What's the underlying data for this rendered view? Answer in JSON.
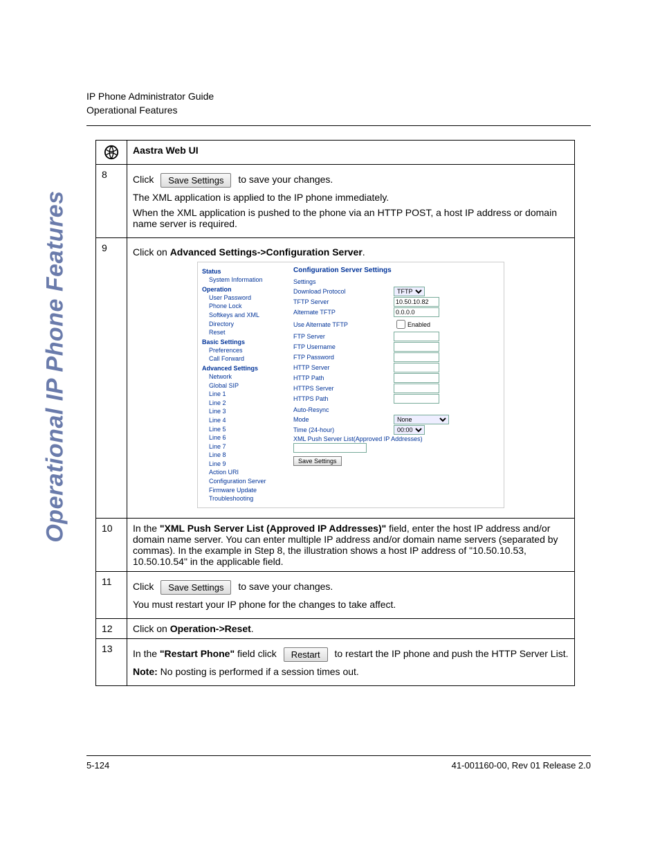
{
  "header": {
    "line1": "IP Phone Administrator Guide",
    "line2": "Operational Features"
  },
  "side_label": "Operational IP Phone Features",
  "table": {
    "title": "Aastra Web UI",
    "rows": {
      "r8": {
        "num": "8",
        "click": "Click",
        "save_btn": "Save Settings",
        "after": " to save your changes.",
        "p2": "The XML application is applied to the IP phone immediately.",
        "p3": "When the XML application is pushed to the phone via an HTTP POST, a host IP address or domain name server is required."
      },
      "r9": {
        "num": "9",
        "text_pre": "Click on ",
        "text_bold": "Advanced Settings->Configuration Server",
        "text_post": "."
      },
      "r10": {
        "num": "10",
        "pre": "In the ",
        "bold1": "\"XML Push Server List (Approved IP Addresses)\"",
        "rest": " field, enter the host IP address and/or domain name server. You can enter multiple IP address and/or domain name servers (separated by commas). In the example in Step 8, the illustration shows a host IP address of \"10.50.10.53, 10.50.10.54\" in the applicable field."
      },
      "r11": {
        "num": "11",
        "click": "Click",
        "save_btn": "Save Settings",
        "after": " to save your changes.",
        "p2": "You must restart your IP phone for the changes to take affect."
      },
      "r12": {
        "num": "12",
        "pre": "Click on ",
        "bold": "Operation->Reset",
        "post": "."
      },
      "r13": {
        "num": "13",
        "pre": "In the ",
        "bold1": "\"Restart Phone\"",
        "mid": " field click",
        "btn": "Restart",
        "after": " to restart the IP phone and push the HTTP Server List.",
        "note_b": "Note:",
        "note_rest": " No posting is performed if a session times out."
      }
    }
  },
  "embed": {
    "nav": {
      "h1": "Status",
      "i1": "System Information",
      "h2": "Operation",
      "i2": "User Password",
      "i3": "Phone Lock",
      "i4": "Softkeys and XML",
      "i5": "Directory",
      "i6": "Reset",
      "h3": "Basic Settings",
      "i7": "Preferences",
      "i8": "Call Forward",
      "h4": "Advanced Settings",
      "i9": "Network",
      "i10": "Global SIP",
      "i11": "Line 1",
      "i12": "Line 2",
      "i13": "Line 3",
      "i14": "Line 4",
      "i15": "Line 5",
      "i16": "Line 6",
      "i17": "Line 7",
      "i18": "Line 8",
      "i19": "Line 9",
      "i20": "Action URI",
      "i21": "Configuration Server",
      "i22": "Firmware Update",
      "i23": "Troubleshooting"
    },
    "conf": {
      "title": "Configuration Server Settings",
      "sec1": "Settings",
      "f1": "Download Protocol",
      "v1": "TFTP",
      "f2": "TFTP Server",
      "v2": "10.50.10.82",
      "f3": "Alternate TFTP",
      "v3": "0.0.0.0",
      "f4": "Use Alternate TFTP",
      "v4": "Enabled",
      "f5": "FTP Server",
      "f6": "FTP Username",
      "f7": "FTP Password",
      "f8": "HTTP Server",
      "f9": "HTTP Path",
      "f10": "HTTPS Server",
      "f11": "HTTPS Path",
      "sec2": "Auto-Resync",
      "f12": "Mode",
      "v12": "None",
      "f13": "Time (24-hour)",
      "v13": "00:00",
      "f14": "XML Push Server List(Approved IP Addresses)",
      "save": "Save Settings"
    }
  },
  "footer": {
    "left": "5-124",
    "right": "41-001160-00, Rev 01  Release 2.0"
  }
}
